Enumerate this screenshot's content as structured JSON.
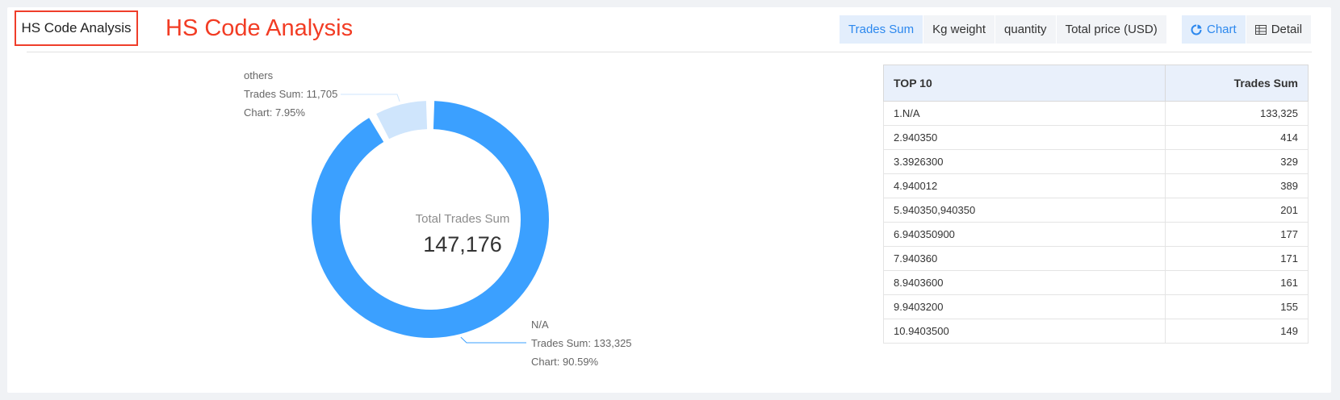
{
  "header": {
    "boxed_title": "HS Code Analysis",
    "title": "HS Code Analysis",
    "metric_tabs": [
      {
        "label": "Trades Sum",
        "active": true
      },
      {
        "label": "Kg weight",
        "active": false
      },
      {
        "label": "quantity",
        "active": false
      },
      {
        "label": "Total price (USD)",
        "active": false
      }
    ],
    "view_toggle": {
      "chart_label": "Chart",
      "detail_label": "Detail",
      "active": "chart"
    }
  },
  "chart_data": {
    "type": "pie",
    "style": "donut",
    "center_label": "Total Trades Sum",
    "center_value": "147,176",
    "slices": [
      {
        "name": "N/A",
        "value": 133325,
        "value_text": "Trades Sum: 133,325",
        "share_text": "Chart: 90.59%",
        "color": "#3ba0ff"
      },
      {
        "name": "others",
        "value": 11705,
        "value_text": "Trades Sum: 11,705",
        "share_text": "Chart: 7.95%",
        "color": "#cfe5fc"
      }
    ]
  },
  "top10": {
    "headers": [
      "TOP 10",
      "Trades Sum"
    ],
    "rows": [
      [
        "1.N/A",
        "133,325"
      ],
      [
        "2.940350",
        "414"
      ],
      [
        "3.3926300",
        "329"
      ],
      [
        "4.940012",
        "389"
      ],
      [
        "5.940350,940350",
        "201"
      ],
      [
        "6.940350900",
        "177"
      ],
      [
        "7.940360",
        "171"
      ],
      [
        "8.9403600",
        "161"
      ],
      [
        "9.9403200",
        "155"
      ],
      [
        "10.9403500",
        "149"
      ]
    ]
  },
  "colors": {
    "accent": "#2c88ee",
    "title_red": "#f23c24",
    "donut_main": "#3ba0ff",
    "donut_other": "#cfe5fc"
  }
}
